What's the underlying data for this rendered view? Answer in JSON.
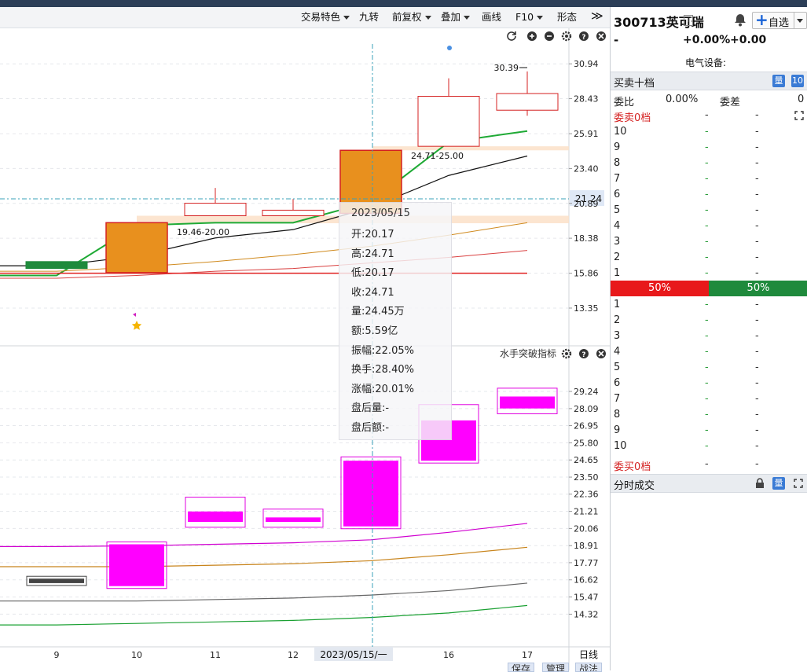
{
  "toolbar": {
    "items": [
      "交易特色",
      "九转",
      "前复权",
      "叠加",
      "画线",
      "F10",
      "形态"
    ],
    "expand_glyph": "≫"
  },
  "price_axis": {
    "labels": [
      "30.94",
      "28.43",
      "25.91",
      "23.40",
      "20.89",
      "18.38",
      "15.86",
      "13.35"
    ],
    "current": "21.24"
  },
  "indicator": {
    "name": "水手突破指标",
    "axis_labels": [
      "29.24",
      "28.09",
      "26.95",
      "25.80",
      "24.65",
      "23.50",
      "22.36",
      "21.21",
      "20.06",
      "18.91",
      "17.77",
      "16.62",
      "15.47",
      "14.32"
    ]
  },
  "x_axis": {
    "labels": [
      "9",
      "10",
      "11",
      "12",
      "16",
      "17"
    ],
    "cursor_label": "2023/05/15/一",
    "period": "日线"
  },
  "annotations": {
    "high_label": "30.39",
    "range_a": "24.71-25.00",
    "range_b": "19.46-20.00"
  },
  "tooltip": {
    "date": "2023/05/15",
    "rows": [
      {
        "k": "开:",
        "v": "20.17"
      },
      {
        "k": "高:",
        "v": "24.71"
      },
      {
        "k": "低:",
        "v": "20.17"
      },
      {
        "k": "收:",
        "v": "24.71"
      },
      {
        "k": "量:",
        "v": "24.45万"
      },
      {
        "k": "额:",
        "v": "5.59亿"
      },
      {
        "k": "振幅:",
        "v": "22.05%"
      },
      {
        "k": "换手:",
        "v": "28.40%"
      },
      {
        "k": "涨幅:",
        "v": "20.01%"
      },
      {
        "k": "盘后量:",
        "v": "-"
      },
      {
        "k": "盘后额:",
        "v": "-"
      }
    ]
  },
  "chart_data": {
    "type": "candlestick",
    "x": [
      "9",
      "10",
      "11",
      "12",
      "2023/05/15",
      "16",
      "17"
    ],
    "open": [
      16.7,
      15.9,
      20.0,
      20.0,
      20.17,
      25.0,
      27.6
    ],
    "close": [
      16.2,
      19.5,
      20.9,
      20.4,
      24.71,
      28.6,
      28.8
    ],
    "high": [
      16.7,
      19.5,
      22.0,
      21.2,
      24.71,
      29.9,
      30.39
    ],
    "low": [
      16.2,
      15.9,
      20.0,
      20.0,
      20.17,
      25.0,
      27.2
    ],
    "ylim": [
      12.5,
      31.8
    ],
    "current_price": 21.24,
    "support_bands": [
      [
        25.0,
        24.71
      ],
      [
        20.0,
        19.46
      ]
    ],
    "ma_lines": {
      "green": [
        15.7,
        19.3,
        19.5,
        19.5,
        21.0,
        25.3,
        26.1
      ],
      "black": [
        16.4,
        17.1,
        18.4,
        19.0,
        20.6,
        22.9,
        24.3
      ],
      "orange": [
        16.0,
        16.3,
        16.7,
        17.2,
        17.8,
        18.6,
        19.5
      ],
      "red": [
        15.5,
        15.7,
        16.0,
        16.2,
        16.6,
        17.0,
        17.5
      ],
      "red_flat": [
        15.86,
        15.86,
        15.86,
        15.86,
        15.86,
        15.86,
        15.86
      ]
    },
    "indicator_bars": {
      "x": [
        "9",
        "10",
        "11",
        "12",
        "2023/05/15",
        "16",
        "17"
      ],
      "inner": [
        [
          16.7,
          16.4
        ],
        [
          19.0,
          16.2
        ],
        [
          21.2,
          20.5
        ],
        [
          20.8,
          20.5
        ],
        [
          24.6,
          20.2
        ],
        [
          27.3,
          24.6
        ],
        [
          28.9,
          28.1
        ]
      ],
      "outer": [
        [
          16.7,
          16.4
        ],
        [
          19.0,
          16.2
        ],
        [
          22.0,
          20.3
        ],
        [
          21.2,
          20.3
        ],
        [
          24.7,
          20.2
        ],
        [
          28.2,
          24.6
        ],
        [
          29.3,
          27.9
        ]
      ],
      "ylim": [
        13.5,
        30.4
      ]
    },
    "indicator_lines": {
      "magenta": [
        18.85,
        18.9,
        19.0,
        19.1,
        19.3,
        19.8,
        20.4
      ],
      "orange": [
        17.5,
        17.5,
        17.6,
        17.7,
        17.9,
        18.3,
        18.8
      ],
      "gray": [
        15.2,
        15.2,
        15.3,
        15.4,
        15.6,
        15.9,
        16.4
      ],
      "green": [
        13.6,
        13.7,
        13.8,
        13.9,
        14.1,
        14.4,
        14.9
      ]
    }
  },
  "panel": {
    "code_name": "300713英可瑞",
    "info": "i",
    "watch_label": "自选",
    "price": "-",
    "pct": "+0.00%",
    "chg": "+0.00",
    "industry": "电气设备:",
    "book_title": "买卖十档",
    "book_badge_a": "量",
    "book_badge_b": "10",
    "wb_label": "委比",
    "wb_value": "0.00%",
    "wc_label": "委差",
    "wc_value": "0",
    "sell_label": "委卖0档",
    "buy_label": "委买0档",
    "dash": "-",
    "sell_levels": [
      "10",
      "9",
      "8",
      "7",
      "6",
      "5",
      "4",
      "3",
      "2",
      "1"
    ],
    "buy_levels": [
      "1",
      "2",
      "3",
      "4",
      "5",
      "6",
      "7",
      "8",
      "9",
      "10"
    ],
    "ratio_red": "50%",
    "ratio_green": "50%",
    "trades_title": "分时成交",
    "bottom_buttons": [
      "保存",
      "管理",
      "战法"
    ]
  },
  "colors": {
    "up": "#d42020",
    "down": "#1f8a3c",
    "highlight": "#e8901e",
    "indicator": "#ff00ff",
    "accent": "#3a7bd5"
  }
}
